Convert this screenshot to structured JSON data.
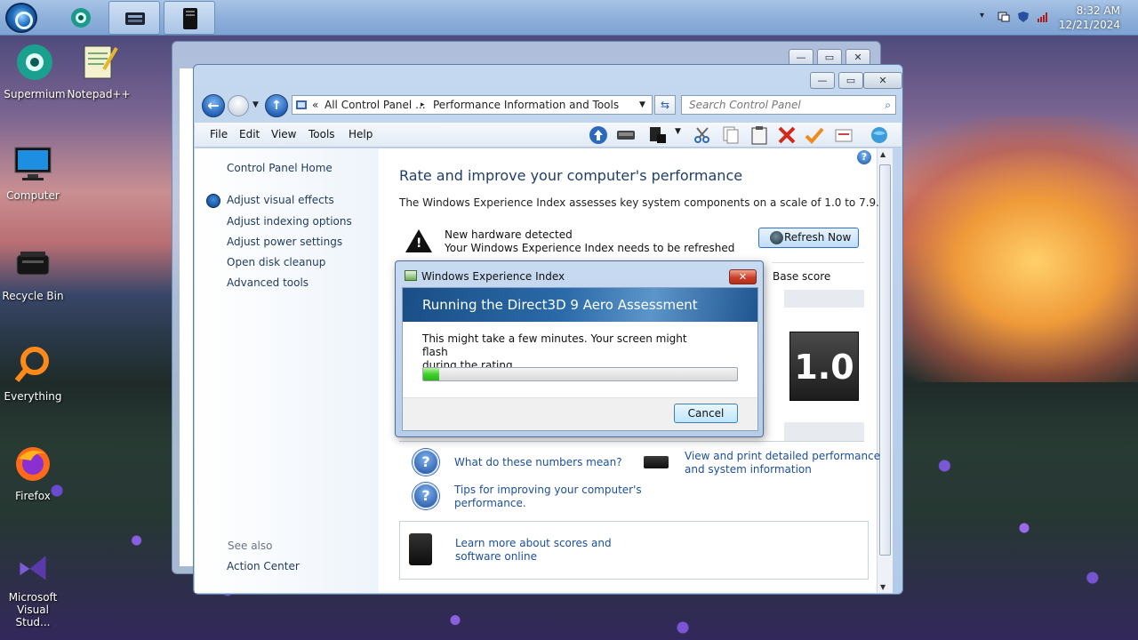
{
  "taskbar": {
    "clock_time": "8:32 AM",
    "clock_date": "12/21/2024"
  },
  "desktop_icons": [
    {
      "label": "Supermium"
    },
    {
      "label": "Notepad++"
    },
    {
      "label": "Computer"
    },
    {
      "label": "Recycle Bin"
    },
    {
      "label": "Everything"
    },
    {
      "label": "Firefox"
    },
    {
      "label": "Microsoft Visual Stud..."
    }
  ],
  "window": {
    "address": {
      "prefix": "«",
      "segment1": "All Control Panel ...",
      "separator": "▸",
      "segment2": "Performance Information and Tools"
    },
    "search_placeholder": "Search Control Panel",
    "menu": [
      "File",
      "Edit",
      "View",
      "Tools",
      "Help"
    ],
    "sidebar": {
      "home": "Control Panel Home",
      "links": [
        "Adjust visual effects",
        "Adjust indexing options",
        "Adjust power settings",
        "Open disk cleanup",
        "Advanced tools"
      ],
      "see_also": "See also",
      "action_center": "Action Center"
    },
    "main": {
      "heading": "Rate and improve your computer's performance",
      "description": "The Windows Experience Index assesses key system components on a scale of 1.0 to 7.9.",
      "hw_title": "New hardware detected",
      "hw_subtitle": "Your Windows Experience Index needs to be refreshed",
      "refresh_button": "Refresh Now",
      "base_score_header": "Base score",
      "base_score": "1.0",
      "link_numbers": "What do these numbers mean?",
      "link_tips_1": "Tips for improving your computer's",
      "link_tips_2": "performance.",
      "link_print_1": "View and print detailed performance",
      "link_print_2": "and system information",
      "link_learn_1": "Learn more about scores and",
      "link_learn_2": "software online"
    }
  },
  "dialog": {
    "title": "Windows Experience Index",
    "banner": "Running the Direct3D 9 Aero Assessment",
    "message_1": "This might take a few minutes. Your screen might flash",
    "message_2": "during the rating.",
    "progress_fraction": 0.05,
    "cancel": "Cancel"
  },
  "colors": {
    "accent": "#1b4f9c",
    "banner": "#2a6aa8",
    "progress": "#3fcf2a",
    "close_red": "#c9402a"
  }
}
